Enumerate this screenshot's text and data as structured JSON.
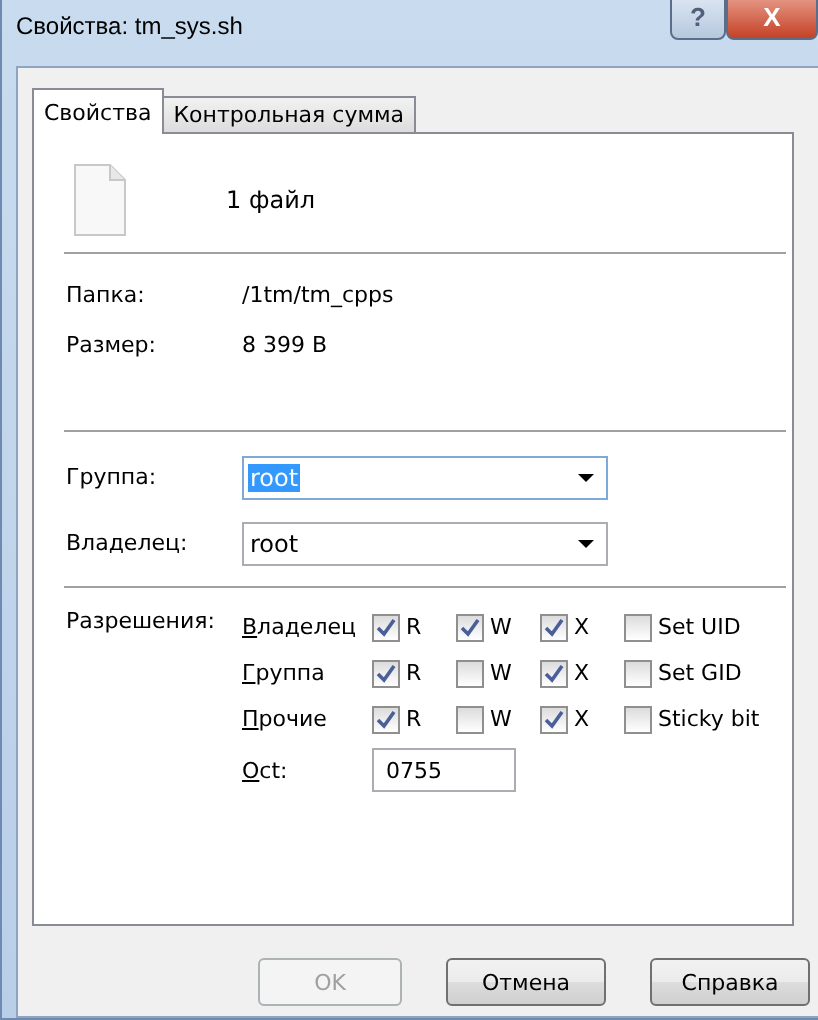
{
  "window": {
    "title": "Свойства: tm_sys.sh",
    "controls": [
      "?",
      "X"
    ]
  },
  "tabs": [
    {
      "label": "Свойства",
      "selected": true
    },
    {
      "label": "Контрольная сумма",
      "selected": false
    }
  ],
  "summary": {
    "count": "1 файл"
  },
  "info": [
    {
      "label": "Папка:",
      "value": "/1tm/tm_cpps"
    },
    {
      "label": "Размер:",
      "value": "8 399 B"
    }
  ],
  "owners": [
    {
      "label": "Группа:",
      "value": "root",
      "selected": true
    },
    {
      "label": "Владелец:",
      "value": "root",
      "selected": false
    }
  ],
  "permissions": {
    "label": "Разрешения:",
    "rows": [
      {
        "name": "Владелец",
        "bits": [
          {
            "label": "R",
            "checked": true
          },
          {
            "label": "W",
            "checked": true
          },
          {
            "label": "X",
            "checked": true
          },
          {
            "label": "Set UID",
            "checked": false
          }
        ]
      },
      {
        "name": "Группа",
        "bits": [
          {
            "label": "R",
            "checked": true
          },
          {
            "label": "W",
            "checked": false
          },
          {
            "label": "X",
            "checked": true
          },
          {
            "label": "Set GID",
            "checked": false
          }
        ]
      },
      {
        "name": "Прочие",
        "bits": [
          {
            "label": "R",
            "checked": true
          },
          {
            "label": "W",
            "checked": false
          },
          {
            "label": "X",
            "checked": true
          },
          {
            "label": "Sticky bit",
            "checked": false
          }
        ]
      }
    ],
    "oct": {
      "label": "Oct:",
      "value": "0755"
    }
  },
  "buttons": [
    {
      "label": "OK",
      "disabled": true
    },
    {
      "label": "Отмена",
      "disabled": false
    },
    {
      "label": "Справка",
      "disabled": false
    }
  ]
}
